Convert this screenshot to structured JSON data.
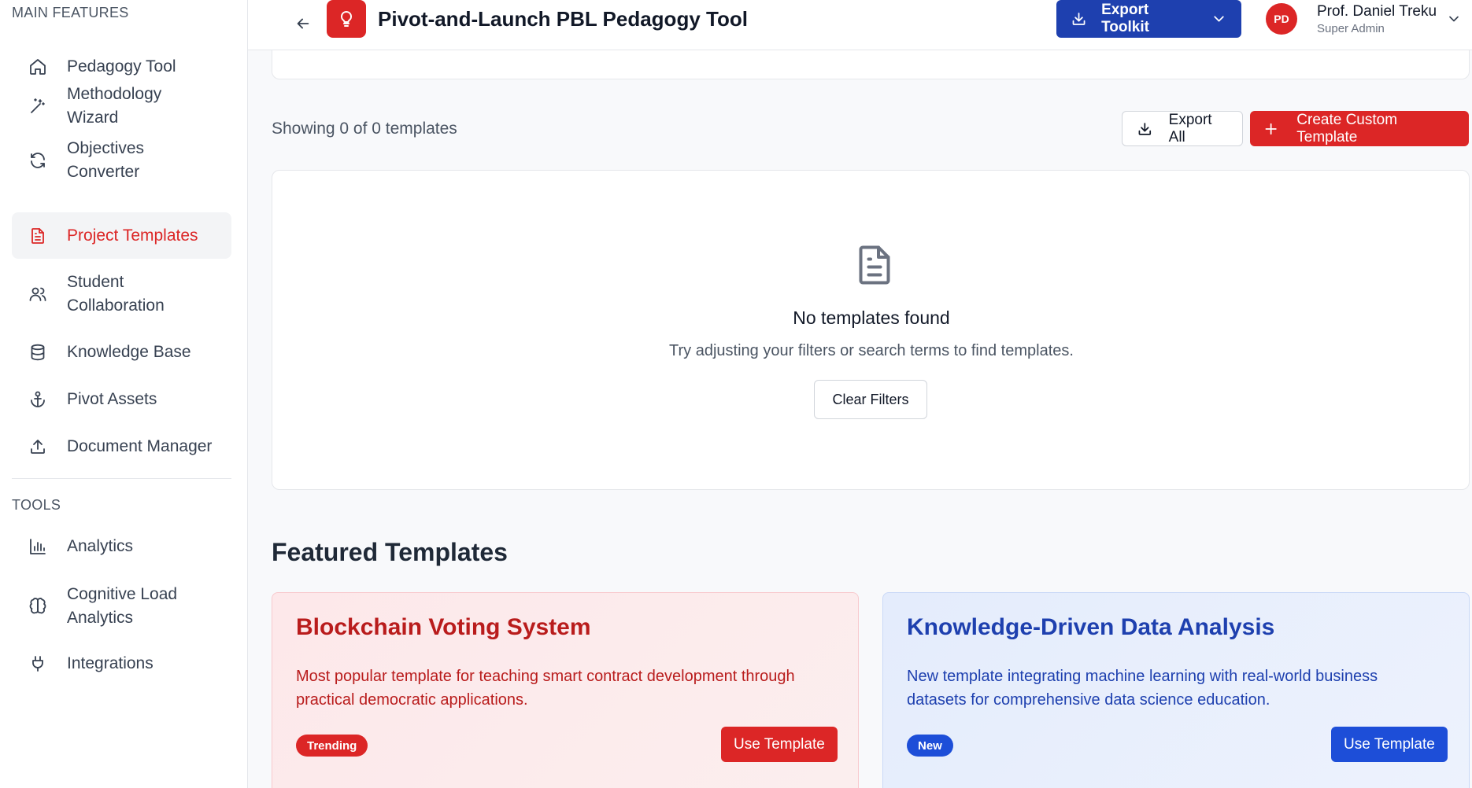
{
  "sidebar": {
    "main_label": "MAIN FEATURES",
    "tools_label": "TOOLS",
    "main_items": [
      {
        "label": "Pedagogy Tool",
        "icon": "home-icon"
      },
      {
        "label": "Methodology Wizard",
        "icon": "magic-wand-icon"
      },
      {
        "label": "Objectives Converter",
        "icon": "refresh-icon"
      },
      {
        "label": "Project Templates",
        "icon": "document-icon",
        "active": true
      },
      {
        "label": "Student Collaboration",
        "icon": "users-icon"
      },
      {
        "label": "Knowledge Base",
        "icon": "database-icon"
      },
      {
        "label": "Pivot Assets",
        "icon": "anchor-icon"
      },
      {
        "label": "Document Manager",
        "icon": "upload-icon"
      }
    ],
    "tool_items": [
      {
        "label": "Analytics",
        "icon": "bar-chart-icon"
      },
      {
        "label": "Cognitive Load Analytics",
        "icon": "brain-icon"
      },
      {
        "label": "Integrations",
        "icon": "plug-icon"
      }
    ]
  },
  "header": {
    "title": "Pivot-and-Launch PBL Pedagogy Tool",
    "export_toolkit_label": "Export Toolkit",
    "user": {
      "initials": "PD",
      "name": "Prof. Daniel Treku",
      "role": "Super Admin"
    }
  },
  "toolbar": {
    "showing_text": "Showing 0 of 0 templates",
    "export_all_label": "Export All",
    "create_label": "Create Custom Template"
  },
  "empty_state": {
    "title": "No templates found",
    "description": "Try adjusting your filters or search terms to find templates.",
    "clear_label": "Clear Filters"
  },
  "featured": {
    "heading": "Featured Templates",
    "cards": [
      {
        "title": "Blockchain Voting System",
        "description": "Most popular template for teaching smart contract development through practical democratic applications.",
        "badge": "Trending",
        "button": "Use Template",
        "accent": "#dc2626"
      },
      {
        "title": "Knowledge-Driven Data Analysis",
        "description": "New template integrating machine learning with real-world business datasets for comprehensive data science education.",
        "badge": "New",
        "button": "Use Template",
        "accent": "#1d4ed8"
      }
    ]
  },
  "colors": {
    "brand_red": "#dc2626",
    "brand_blue": "#1e40af"
  }
}
